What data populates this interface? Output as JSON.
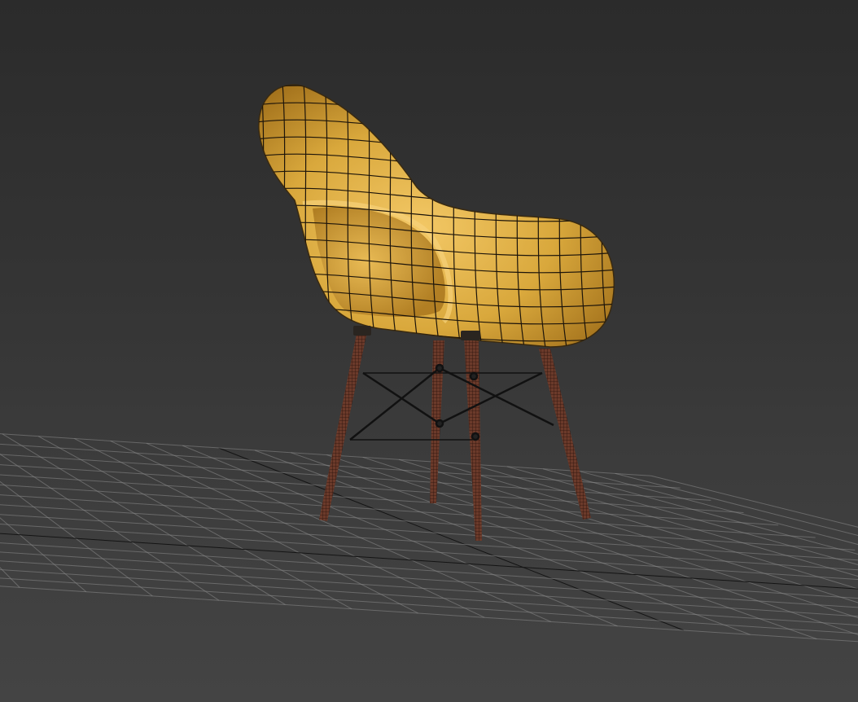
{
  "viewport": {
    "background_top": "#2b2b2b",
    "background_bottom": "#444444",
    "grid_color": "#8c8c8c",
    "grid_axis_color": "#141414"
  },
  "scene": {
    "object": "chair-icon",
    "shell_color": "#d9a83c",
    "shell_shade": "#a9761d",
    "shell_highlight": "#f3c866",
    "wire_color": "#1c140a",
    "leg_color": "#6b3a2a",
    "leg_wire_color": "#2a120c",
    "cross_brace_color": "#111111"
  }
}
